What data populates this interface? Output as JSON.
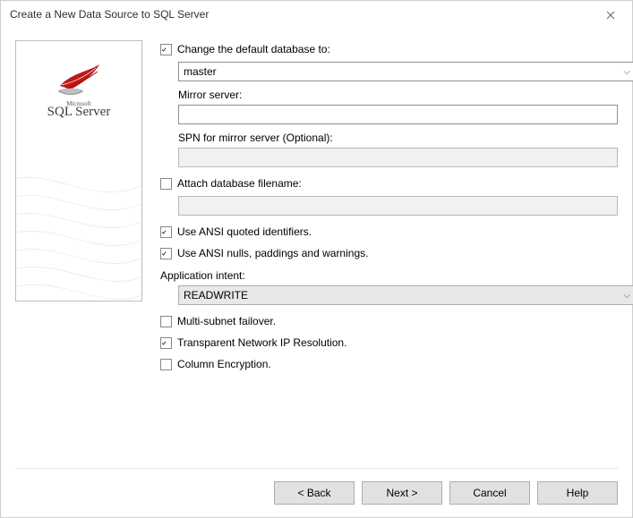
{
  "window": {
    "title": "Create a New Data Source to SQL Server"
  },
  "side": {
    "brand_prefix": "Microsoft",
    "brand": "SQL Server",
    "icon_name": "sqlserver-logo"
  },
  "form": {
    "change_db": {
      "label": "Change the default database to:",
      "checked": true,
      "value": "master"
    },
    "mirror": {
      "label": "Mirror server:",
      "value": ""
    },
    "spn": {
      "label": "SPN for mirror server (Optional):",
      "value": ""
    },
    "attach": {
      "label": "Attach database filename:",
      "checked": false,
      "value": ""
    },
    "ansi_quoted": {
      "label": "Use ANSI quoted identifiers.",
      "checked": true
    },
    "ansi_nulls": {
      "label": "Use ANSI nulls, paddings and warnings.",
      "checked": true
    },
    "intent": {
      "label": "Application intent:",
      "value": "READWRITE"
    },
    "multi_subnet": {
      "label": "Multi-subnet failover.",
      "checked": false
    },
    "tnir": {
      "label": "Transparent Network IP Resolution.",
      "checked": true
    },
    "col_enc": {
      "label": "Column Encryption.",
      "checked": false
    }
  },
  "buttons": {
    "back": "< Back",
    "next": "Next >",
    "cancel": "Cancel",
    "help": "Help"
  }
}
